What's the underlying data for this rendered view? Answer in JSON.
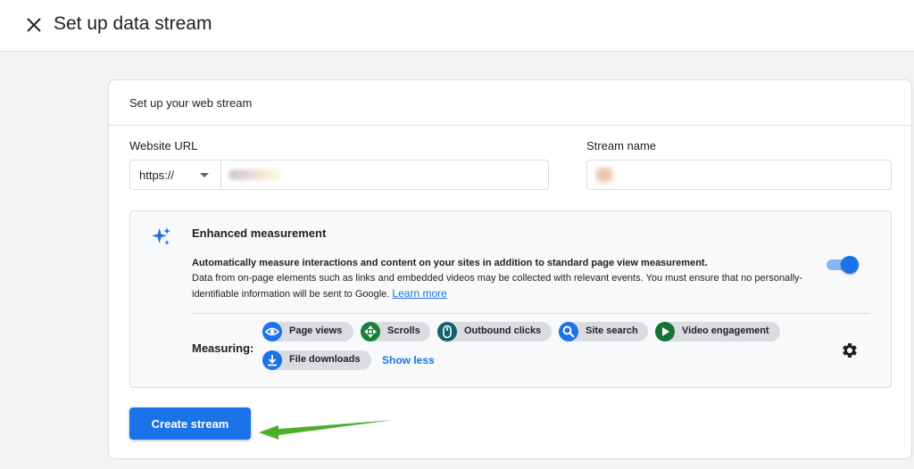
{
  "header": {
    "title": "Set up data stream"
  },
  "card": {
    "title": "Set up your web stream",
    "website_url": {
      "label": "Website URL",
      "protocol": "https://",
      "value": ""
    },
    "stream_name": {
      "label": "Stream name",
      "value": ""
    },
    "enhanced_measurement": {
      "title": "Enhanced measurement",
      "description_bold": "Automatically measure interactions and content on your sites in addition to standard page view measurement.",
      "description": "Data from on-page elements such as links and embedded videos may be collected with relevant events. You must ensure that no personally-identifiable information will be sent to Google.",
      "learn_more": "Learn more",
      "enabled": true,
      "measuring_label": "Measuring:",
      "chips": [
        {
          "label": "Page views",
          "icon": "eye-icon",
          "color": "#1a73e8"
        },
        {
          "label": "Scrolls",
          "icon": "scroll-icon",
          "color": "#188038"
        },
        {
          "label": "Outbound clicks",
          "icon": "mouse-icon",
          "color": "#12616e"
        },
        {
          "label": "Site search",
          "icon": "search-icon",
          "color": "#1a73e8"
        },
        {
          "label": "Video engagement",
          "icon": "play-icon",
          "color": "#137333"
        },
        {
          "label": "File downloads",
          "icon": "download-icon",
          "color": "#1a73e8"
        }
      ],
      "show_less": "Show less"
    },
    "create_button": "Create stream"
  },
  "colors": {
    "primary": "#1a73e8",
    "arrow": "#4caf2a"
  }
}
